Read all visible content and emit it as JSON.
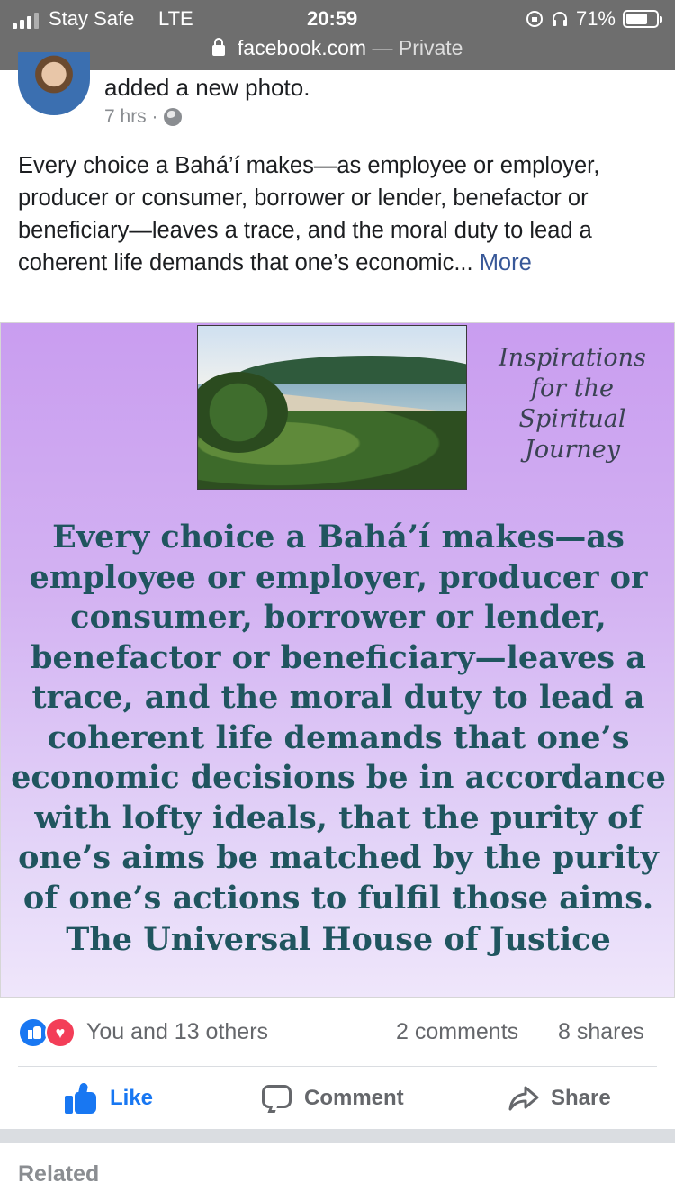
{
  "status_bar": {
    "carrier": "Stay Safe",
    "network": "LTE",
    "time": "20:59",
    "battery_percent": "71%",
    "battery_level": 0.71,
    "url_host": "facebook.com",
    "url_suffix": "— Private"
  },
  "post": {
    "action_text": "added a new photo.",
    "time_ago": "7 hrs ·",
    "body": "Every choice a Bahá’í makes—as employee or employer, producer or consumer, borrower or lender, benefactor or beneficiary—leaves a trace, and the moral duty to lead a coherent life demands that one’s economic...",
    "more_link": "More"
  },
  "photo": {
    "inspiration_title": "Inspirations\nfor the\nSpiritual\nJourney",
    "quote": "Every choice a Bahá’í makes—as employee or employer, producer or consumer, borrower or lender, benefactor or beneficiary—leaves a trace, and the moral duty to lead a coherent life demands that one’s economic decisions be in accordance with lofty ideals, that the purity of one’s aims be matched by the purity of one’s actions to fulfil those aims.",
    "attribution": "The Universal House of Justice",
    "colors": {
      "background_top": "#c99df0",
      "background_bottom": "#efe6fb",
      "quote_text": "#20555f"
    }
  },
  "engagement": {
    "reactions_text": "You and 13 others",
    "comments": "2 comments",
    "shares": "8 shares"
  },
  "actions": {
    "like": "Like",
    "comment": "Comment",
    "share": "Share"
  },
  "related": {
    "label": "Related"
  },
  "colors": {
    "accent": "#1877f2",
    "love": "#f33e58",
    "link": "#385898",
    "status_bar": "#6e6e6e"
  }
}
